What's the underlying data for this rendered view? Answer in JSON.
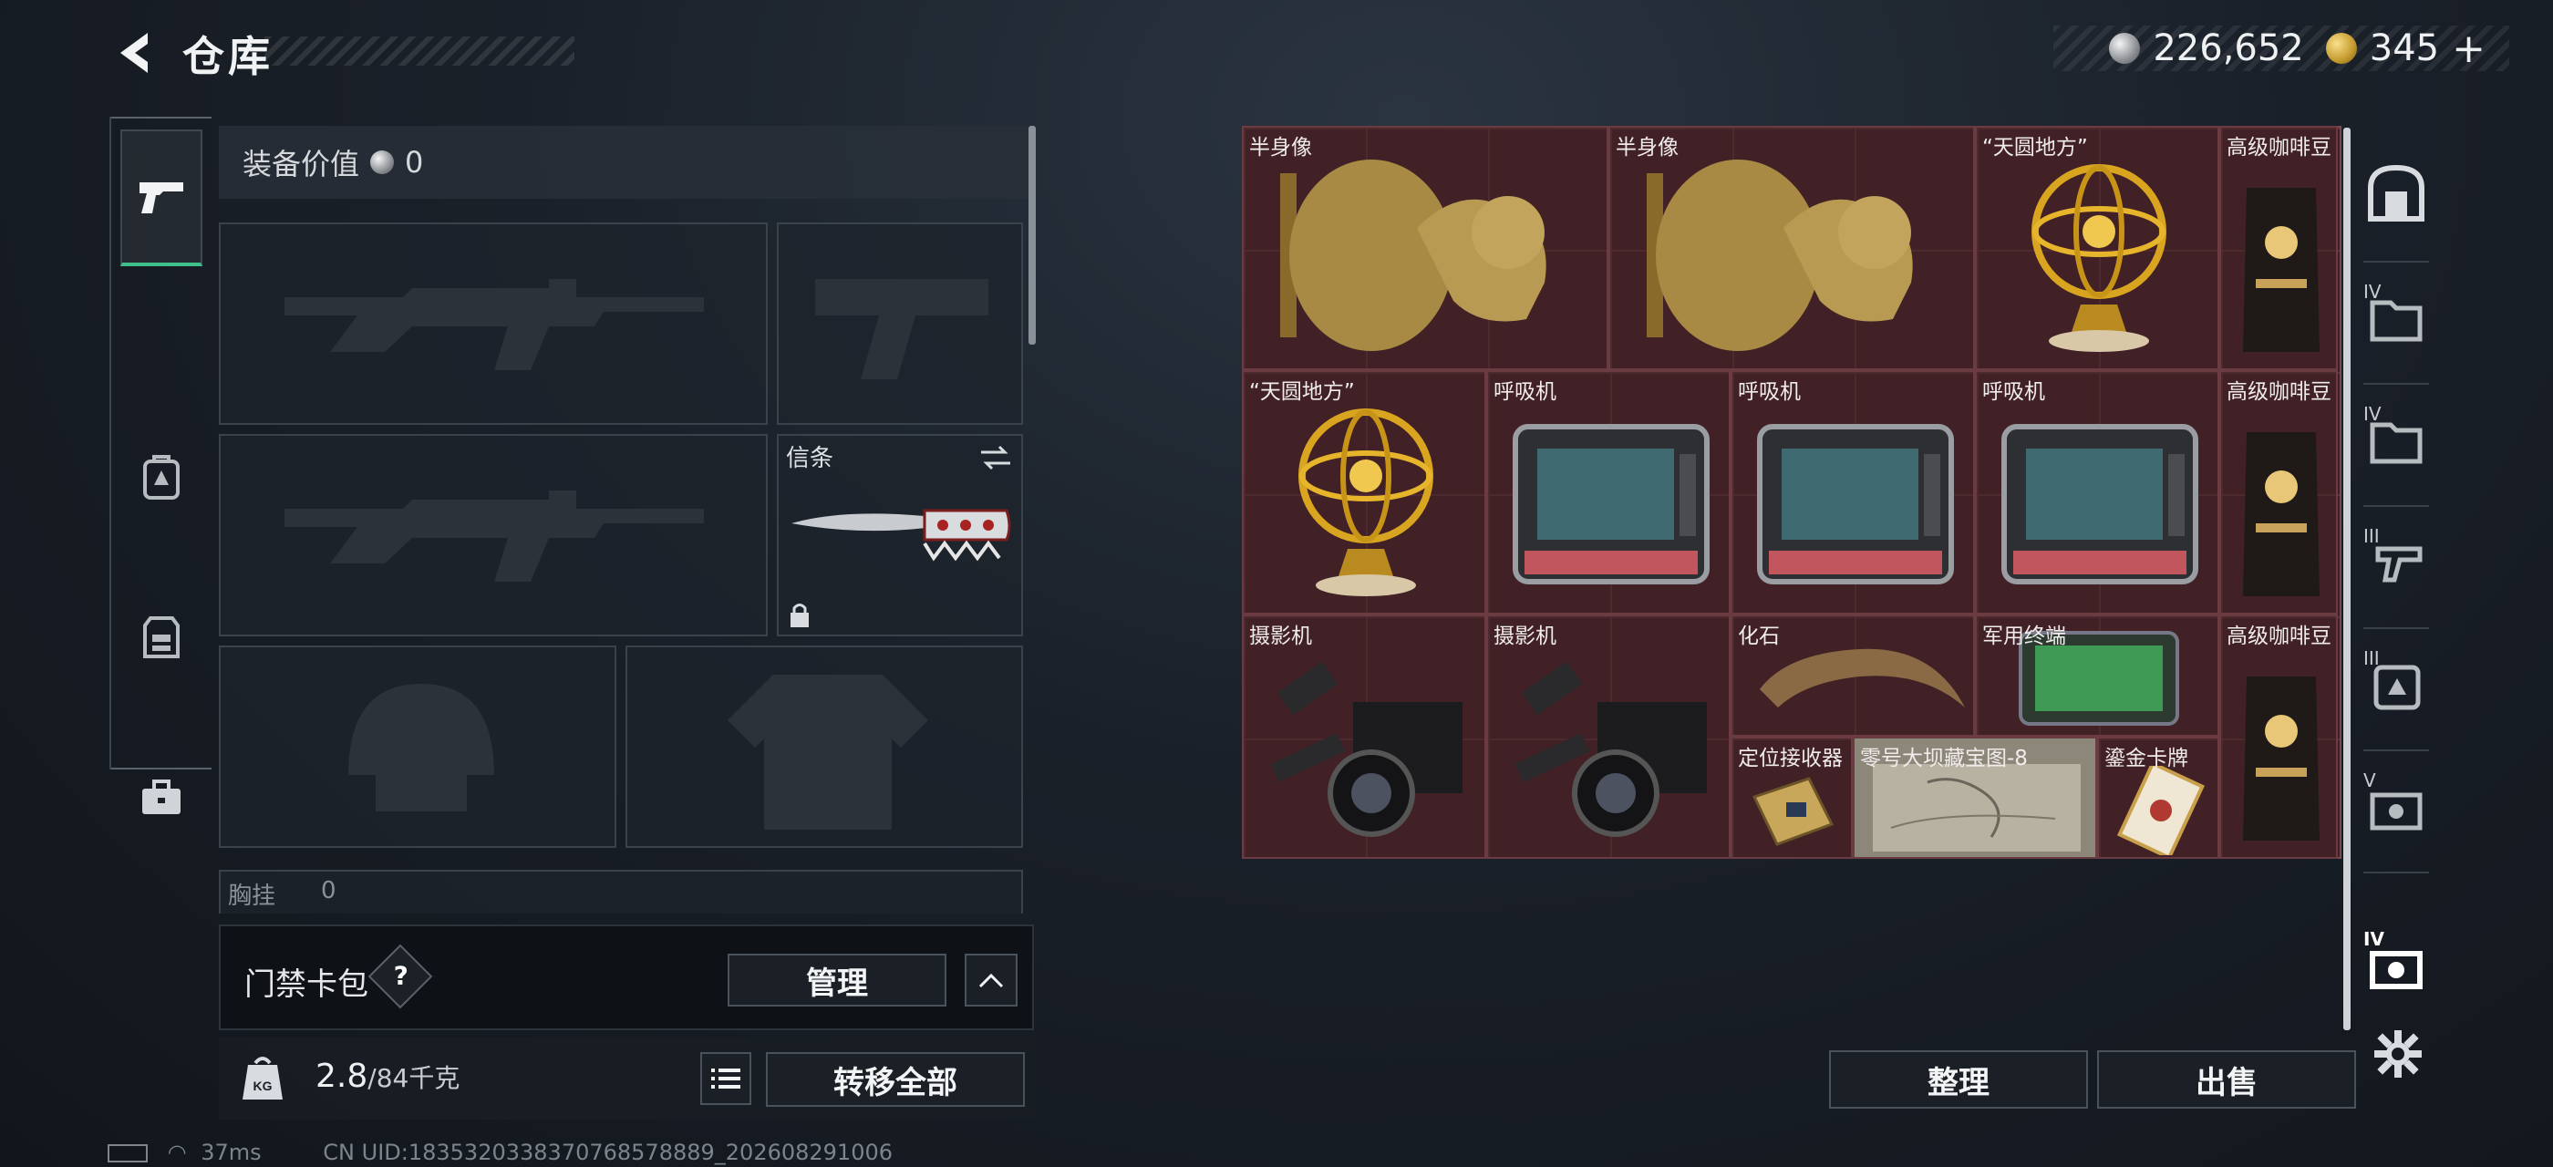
{
  "header": {
    "title": "仓库",
    "back_icon": "back-arrow-icon"
  },
  "currency": {
    "silver_value": "226,652",
    "gold_value": "345",
    "gold_add": "+"
  },
  "left_tabs": [
    {
      "name": "weapons",
      "icon": "pistol-icon",
      "active": true
    },
    {
      "name": "gear",
      "icon": "backpack-icon",
      "active": false
    },
    {
      "name": "vest",
      "icon": "vest-icon",
      "active": false
    },
    {
      "name": "case",
      "icon": "briefcase-icon",
      "active": false
    }
  ],
  "equip": {
    "value_label": "装备价值",
    "value": "0",
    "melee_label": "信条",
    "chest_label": "胸挂",
    "chest_value": "0"
  },
  "card_pack": {
    "label": "门禁卡包",
    "help": "?",
    "manage_button": "管理"
  },
  "weight": {
    "current": "2.8",
    "max": "/84千克",
    "transfer_all": "转移全部"
  },
  "stash_items": [
    {
      "name": "半身像"
    },
    {
      "name": "半身像"
    },
    {
      "name": "“天圆地方”"
    },
    {
      "name": "高级咖啡豆"
    },
    {
      "name": "“天圆地方”"
    },
    {
      "name": "呼吸机"
    },
    {
      "name": "呼吸机"
    },
    {
      "name": "呼吸机"
    },
    {
      "name": "高级咖啡豆"
    },
    {
      "name": "摄影机"
    },
    {
      "name": "摄影机"
    },
    {
      "name": "化石"
    },
    {
      "name": "军用终端"
    },
    {
      "name": "高级咖啡豆"
    },
    {
      "name": "定位接收器"
    },
    {
      "name": "零号大坝藏宝图-8"
    },
    {
      "name": "鎏金卡牌"
    }
  ],
  "right_col": {
    "tier_labels": [
      "IV",
      "IV",
      "III",
      "III",
      "V",
      "IV"
    ],
    "settings_icon": "gear-icon"
  },
  "actions": {
    "organize": "整理",
    "sell": "出售"
  },
  "status": {
    "ping": "37ms",
    "uid": "CN UID:1835320338370768578889_202608291006"
  },
  "colors": {
    "accent_green": "#3fc08b",
    "stash_bg": "#3d2024"
  }
}
